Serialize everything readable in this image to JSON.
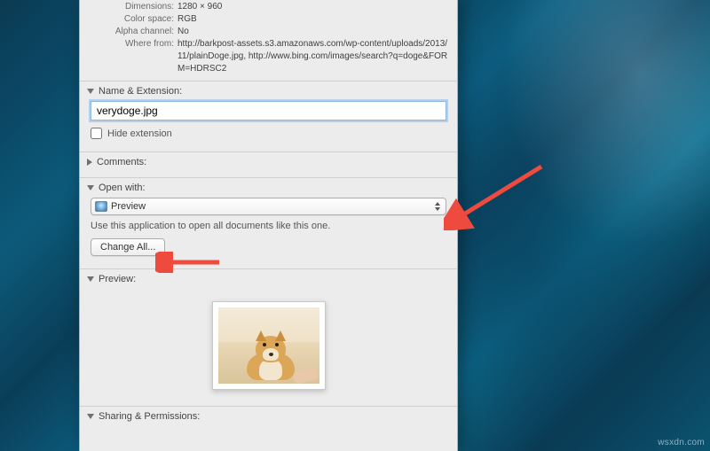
{
  "info": {
    "dimensions_label": "Dimensions:",
    "dimensions_value": "1280 × 960",
    "colorspace_label": "Color space:",
    "colorspace_value": "RGB",
    "alpha_label": "Alpha channel:",
    "alpha_value": "No",
    "where_label": "Where from:",
    "where_value": "http://barkpost-assets.s3.amazonaws.com/wp-content/uploads/2013/11/plainDoge.jpg, http://www.bing.com/images/search?q=doge&FORM=HDRSC2"
  },
  "name_ext": {
    "section_label": "Name & Extension:",
    "filename": "verydoge.jpg",
    "hide_ext_label": "Hide extension"
  },
  "comments": {
    "section_label": "Comments:"
  },
  "open_with": {
    "section_label": "Open with:",
    "selected_app": "Preview",
    "helper_text": "Use this application to open all documents like this one.",
    "change_all_label": "Change All..."
  },
  "preview": {
    "section_label": "Preview:"
  },
  "sharing": {
    "section_label": "Sharing & Permissions:"
  },
  "watermark": "wsxdn.com"
}
